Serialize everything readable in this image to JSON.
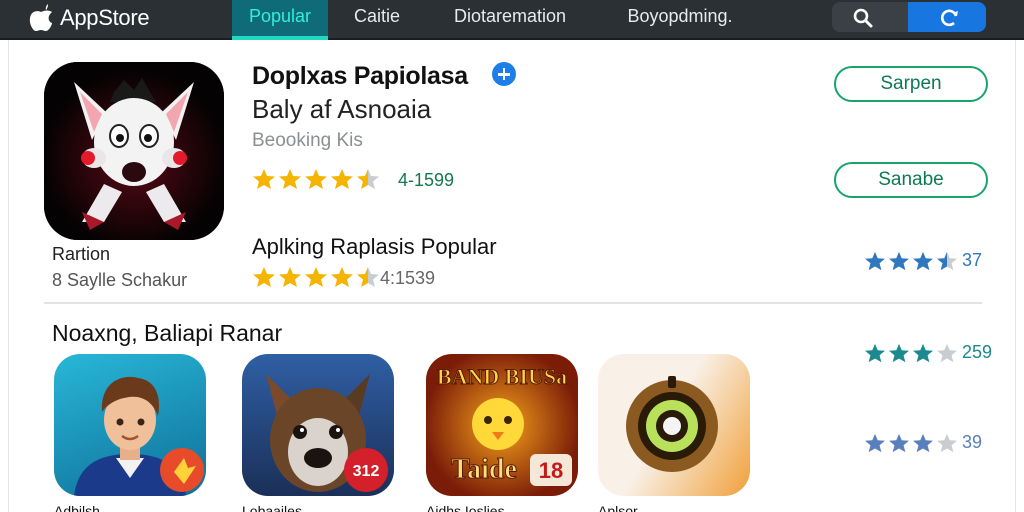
{
  "app": {
    "name": "AppStore"
  },
  "nav": {
    "tabs": [
      "Popular",
      "Caitie",
      "Diotaremation",
      "Boyopdming."
    ]
  },
  "featured": {
    "title": "Doplxas Papiolasa",
    "subtitle": "Baly af Asnoaia",
    "category": "Beooking Kis",
    "rating": 4.5,
    "rating_count": "4-1599",
    "primary_button": "Sarpen",
    "secondary_button": "Sanabe",
    "left_label": "Rartion",
    "left_sub": "8 Saylle Schakur"
  },
  "popular_item": {
    "title": "Aplking Raplasis Popular",
    "rating": 4.5,
    "rating_count": "4:1539"
  },
  "section": {
    "title": "Noaxng, Baliapi Ranar"
  },
  "side_ratings": [
    {
      "stars": 3.5,
      "value": "37",
      "color": "#2f78c0"
    },
    {
      "stars": 3,
      "value": "259",
      "color": "#1a8a8e"
    },
    {
      "stars": 3,
      "value": "39",
      "color": "#5a7fbd"
    }
  ],
  "tiles": [
    {
      "caption": "Adbilsh"
    },
    {
      "caption": "Lobaailes"
    },
    {
      "caption": "Aidhs Ioslies"
    },
    {
      "caption": "Aplsor"
    }
  ],
  "tile_badges": {
    "tile2": "312",
    "tile3_top": "BAND BIUSa",
    "tile3_bottom": "Taide",
    "tile3_num": "18"
  },
  "colors": {
    "topbar": "#2b3035",
    "active_tab": "#1fd8c0",
    "accent_green": "#18a46a",
    "star_gold": "#f4b400",
    "account_blue": "#1876e0"
  }
}
